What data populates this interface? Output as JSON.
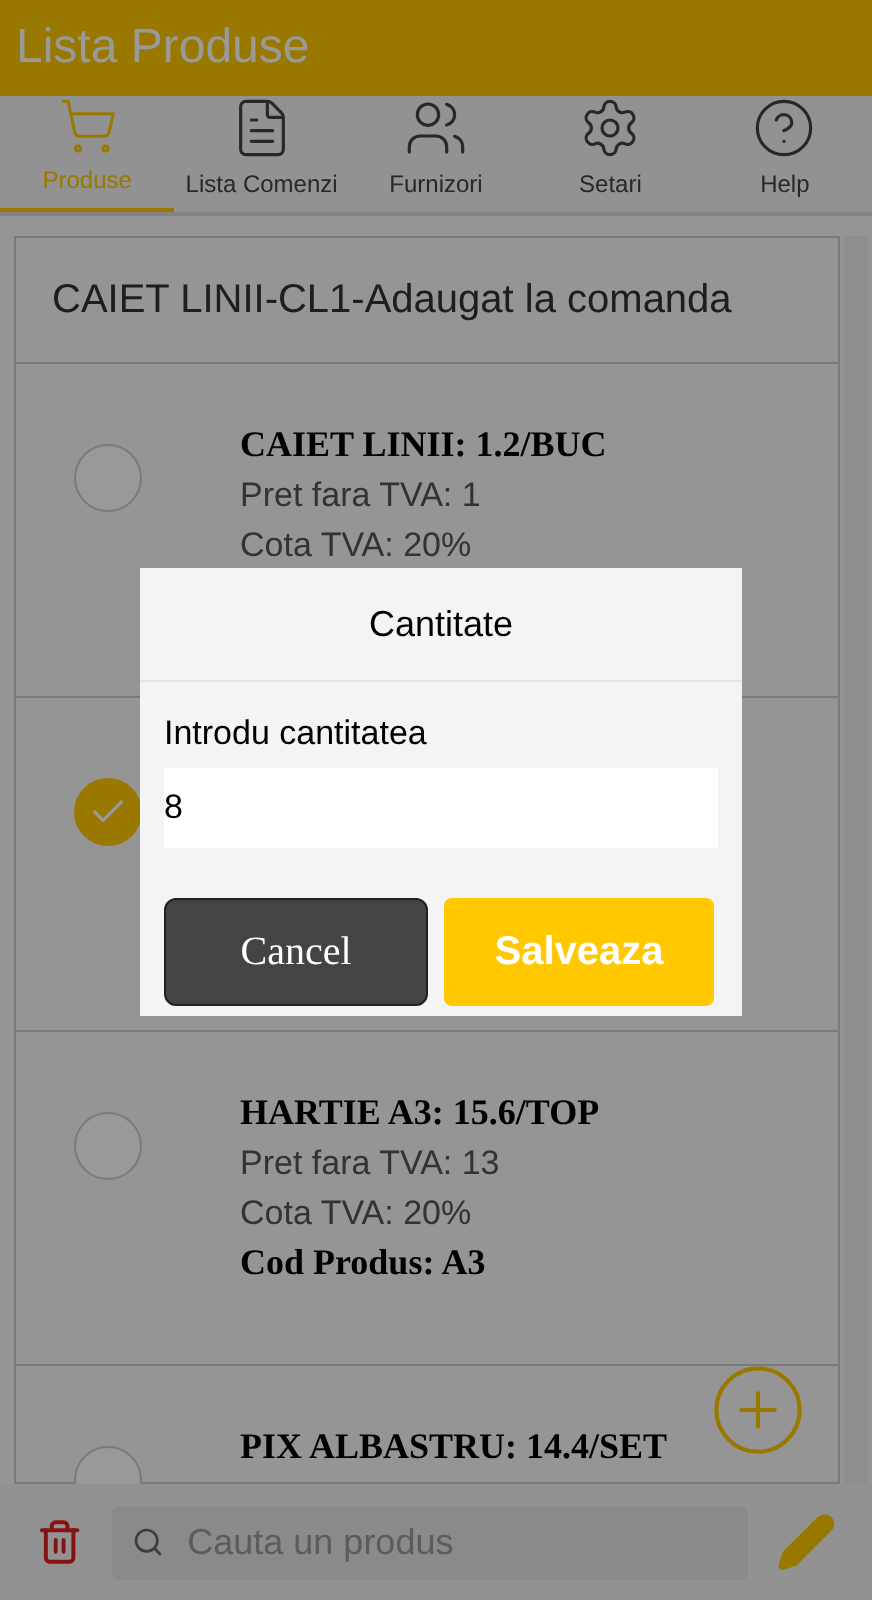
{
  "header": {
    "title": "Lista Produse"
  },
  "tabs": [
    {
      "label": "Produse",
      "kind": "cart",
      "selected": true
    },
    {
      "label": "Lista Comenzi",
      "kind": "list",
      "selected": false
    },
    {
      "label": "Furnizori",
      "kind": "people",
      "selected": false
    },
    {
      "label": "Setari",
      "kind": "settings",
      "selected": false
    },
    {
      "label": "Help",
      "kind": "help",
      "selected": false
    }
  ],
  "order_banner": "CAIET LINII-CL1-Adaugat la comanda",
  "products": [
    {
      "title": "CAIET LINII: 1.2/BUC",
      "price": "Pret fara TVA: 1",
      "vat": "Cota TVA: 20%",
      "checked": false
    },
    {
      "checked": true
    },
    {
      "title": "HARTIE A3: 15.6/TOP",
      "price": "Pret fara TVA: 13",
      "vat": "Cota TVA: 20%",
      "code": "Cod Produs: A3",
      "checked": false
    },
    {
      "title": "PIX ALBASTRU: 14.4/SET",
      "checked": false
    }
  ],
  "search": {
    "placeholder": "Cauta un produs"
  },
  "dialog": {
    "title": "Cantitate",
    "label": "Introdu cantitatea",
    "value": "8",
    "buttons": [
      {
        "label": "Cancel",
        "kind": "secondary"
      },
      {
        "label": "Salveaza",
        "kind": "primary"
      }
    ]
  }
}
